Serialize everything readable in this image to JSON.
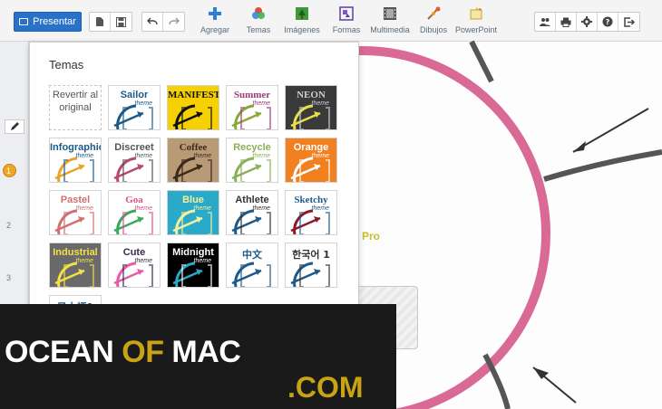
{
  "toolbar": {
    "present_label": "Presentar",
    "tools": [
      {
        "label": "Agregar",
        "icon": "plus-icon"
      },
      {
        "label": "Temas",
        "icon": "themes-icon"
      },
      {
        "label": "Imágenes",
        "icon": "image-icon"
      },
      {
        "label": "Formas",
        "icon": "shapes-icon"
      },
      {
        "label": "Multimedia",
        "icon": "film-icon"
      },
      {
        "label": "Dibujos",
        "icon": "drawing-icon"
      },
      {
        "label": "PowerPoint",
        "icon": "powerpoint-icon"
      }
    ]
  },
  "sidebar": {
    "slides": [
      "1",
      "2",
      "3"
    ]
  },
  "themes_popup": {
    "title": "Temas",
    "revert_label": "Revertir al original",
    "themes": [
      {
        "name": "Sailor",
        "sub": "theme"
      },
      {
        "name": "MANIFESTO",
        "sub": ""
      },
      {
        "name": "Summer",
        "sub": "theme"
      },
      {
        "name": "NEON",
        "sub": "theme"
      },
      {
        "name": "Infographic",
        "sub": "theme"
      },
      {
        "name": "Discreet",
        "sub": "theme"
      },
      {
        "name": "Coffee",
        "sub": "theme"
      },
      {
        "name": "Recycle",
        "sub": "theme"
      },
      {
        "name": "Orange",
        "sub": "theme"
      },
      {
        "name": "Pastel",
        "sub": "theme"
      },
      {
        "name": "Goa",
        "sub": "theme"
      },
      {
        "name": "Blue",
        "sub": "theme"
      },
      {
        "name": "Athlete",
        "sub": "theme"
      },
      {
        "name": "Sketchy",
        "sub": "theme"
      },
      {
        "name": "Industrial",
        "sub": "theme"
      },
      {
        "name": "Cute",
        "sub": "theme"
      },
      {
        "name": "Midnight",
        "sub": "theme"
      },
      {
        "name": "中文",
        "sub": ""
      },
      {
        "name": "한국어 1",
        "sub": ""
      },
      {
        "name": "日本語1",
        "sub": ""
      }
    ]
  },
  "canvas": {
    "partial_text": "Pro"
  },
  "watermark": {
    "ocean": "OCEAN",
    "of": "OF",
    "mac": "MAC",
    "com": ".COM"
  },
  "colors": {
    "accent": "#2a72c8",
    "circle": "#d86a95",
    "watermark_gold": "#c8a415"
  }
}
